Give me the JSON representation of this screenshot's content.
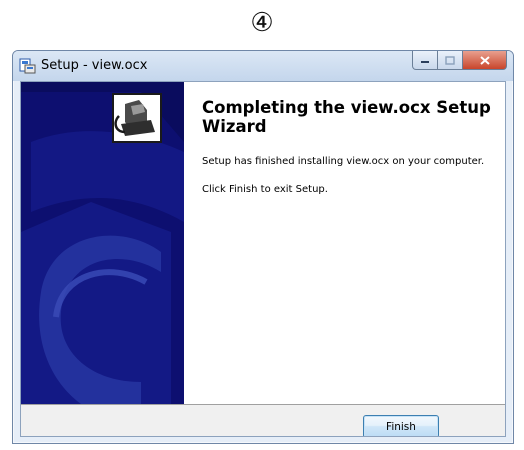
{
  "step_marker": "④",
  "window": {
    "title": "Setup - view.ocx",
    "icon": "setup-installer-icon"
  },
  "wizard": {
    "heading": "Completing the view.ocx Setup Wizard",
    "message_installed": "Setup has finished installing view.ocx on your computer.",
    "message_exit": "Click Finish to exit Setup.",
    "finish_label": "Finish"
  },
  "colors": {
    "banner": "#0d0f70",
    "close_button": "#c9452b"
  }
}
